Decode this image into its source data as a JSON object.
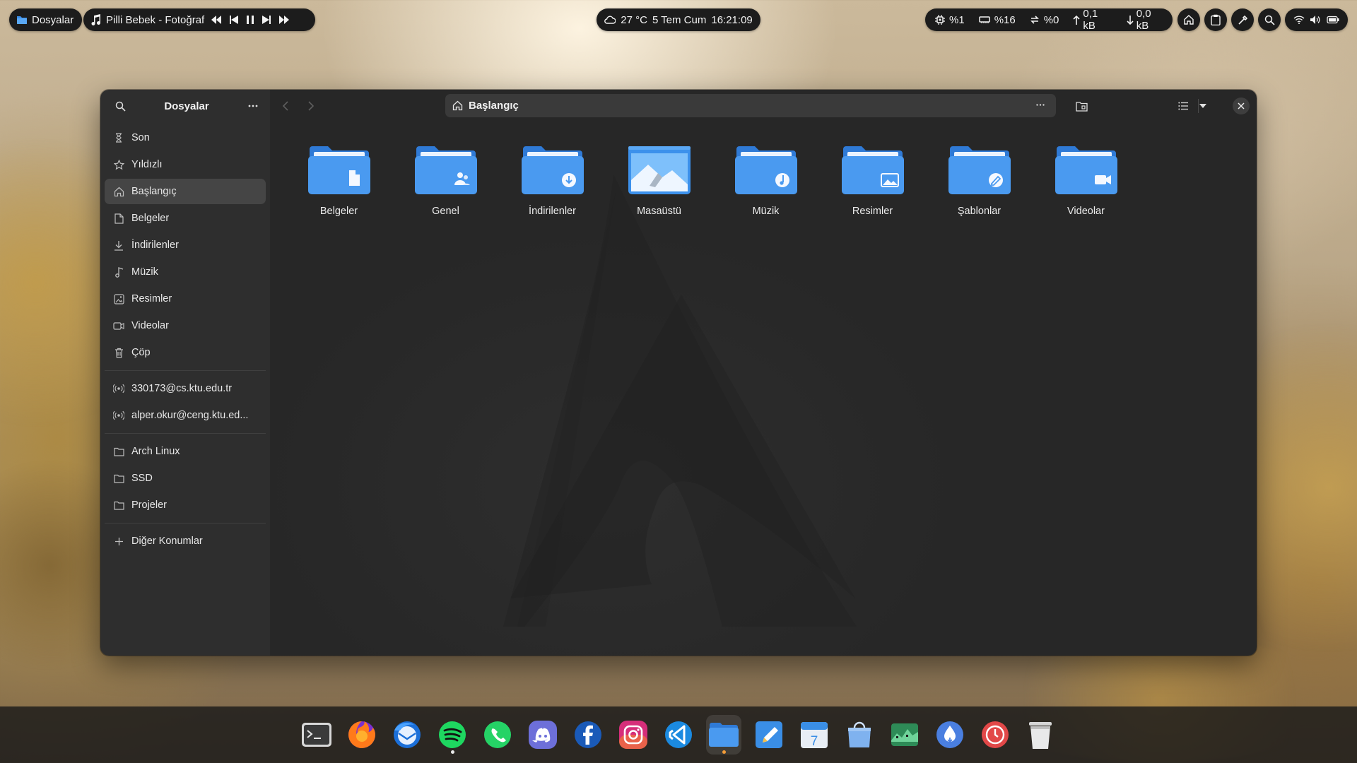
{
  "topbar": {
    "activities_label": "Dosyalar",
    "media": {
      "title": "Pilli Bebek - Fotoğraf",
      "prev_icon": "seek-backward-icon",
      "skip_prev_icon": "skip-previous-icon",
      "pause_icon": "pause-icon",
      "skip_next_icon": "skip-next-icon",
      "next_icon": "seek-forward-icon"
    },
    "clock": {
      "weather": "27 °C",
      "date": "5 Tem Cum",
      "time": "16:21:09"
    },
    "system": {
      "cpu": "%1",
      "memory": "%16",
      "swap": "%0",
      "upload": "0,1 kB",
      "download": "0,0 kB"
    }
  },
  "window": {
    "sidebar": {
      "title": "Dosyalar",
      "places": [
        {
          "label": "Son",
          "icon": "clock-icon"
        },
        {
          "label": "Yıldızlı",
          "icon": "star-icon"
        },
        {
          "label": "Başlangıç",
          "icon": "home-icon"
        },
        {
          "label": "Belgeler",
          "icon": "document-icon"
        },
        {
          "label": "İndirilenler",
          "icon": "download-icon"
        },
        {
          "label": "Müzik",
          "icon": "music-icon"
        },
        {
          "label": "Resimler",
          "icon": "image-icon"
        },
        {
          "label": "Videolar",
          "icon": "video-icon"
        },
        {
          "label": "Çöp",
          "icon": "trash-icon"
        }
      ],
      "network": [
        {
          "label": "330173@cs.ktu.edu.tr",
          "icon": "network-icon"
        },
        {
          "label": "alper.okur@ceng.ktu.ed...",
          "icon": "network-icon"
        }
      ],
      "bookmarks": [
        {
          "label": "Arch Linux",
          "icon": "folder-icon"
        },
        {
          "label": "SSD",
          "icon": "folder-icon"
        },
        {
          "label": "Projeler",
          "icon": "folder-icon"
        }
      ],
      "other_locations": "Diğer Konumlar"
    },
    "path": "Başlangıç",
    "files": [
      {
        "label": "Belgeler",
        "emblem": "document"
      },
      {
        "label": "Genel",
        "emblem": "people"
      },
      {
        "label": "İndirilenler",
        "emblem": "download"
      },
      {
        "label": "Masaüstü",
        "emblem": "desktop"
      },
      {
        "label": "Müzik",
        "emblem": "music"
      },
      {
        "label": "Resimler",
        "emblem": "image"
      },
      {
        "label": "Şablonlar",
        "emblem": "template"
      },
      {
        "label": "Videolar",
        "emblem": "video"
      }
    ]
  },
  "dock": [
    {
      "name": "terminal-icon"
    },
    {
      "name": "firefox-icon"
    },
    {
      "name": "thunderbird-icon"
    },
    {
      "name": "spotify-icon",
      "running": true
    },
    {
      "name": "whatsapp-icon"
    },
    {
      "name": "discord-icon"
    },
    {
      "name": "facebook-icon"
    },
    {
      "name": "instagram-icon"
    },
    {
      "name": "vscode-icon"
    },
    {
      "name": "files-icon",
      "running": true,
      "active": true
    },
    {
      "name": "text-editor-icon"
    },
    {
      "name": "calendar-icon",
      "day": "7"
    },
    {
      "name": "software-store-icon"
    },
    {
      "name": "system-monitor-icon"
    },
    {
      "name": "drop-icon"
    },
    {
      "name": "timer-icon"
    },
    {
      "name": "trash-dock-icon"
    }
  ],
  "colors": {
    "accent": "#3b8ee8",
    "folder_front": "#4a9af0",
    "folder_back": "#2f7ad6",
    "spotify": "#1ed760",
    "whatsapp": "#25d366"
  }
}
